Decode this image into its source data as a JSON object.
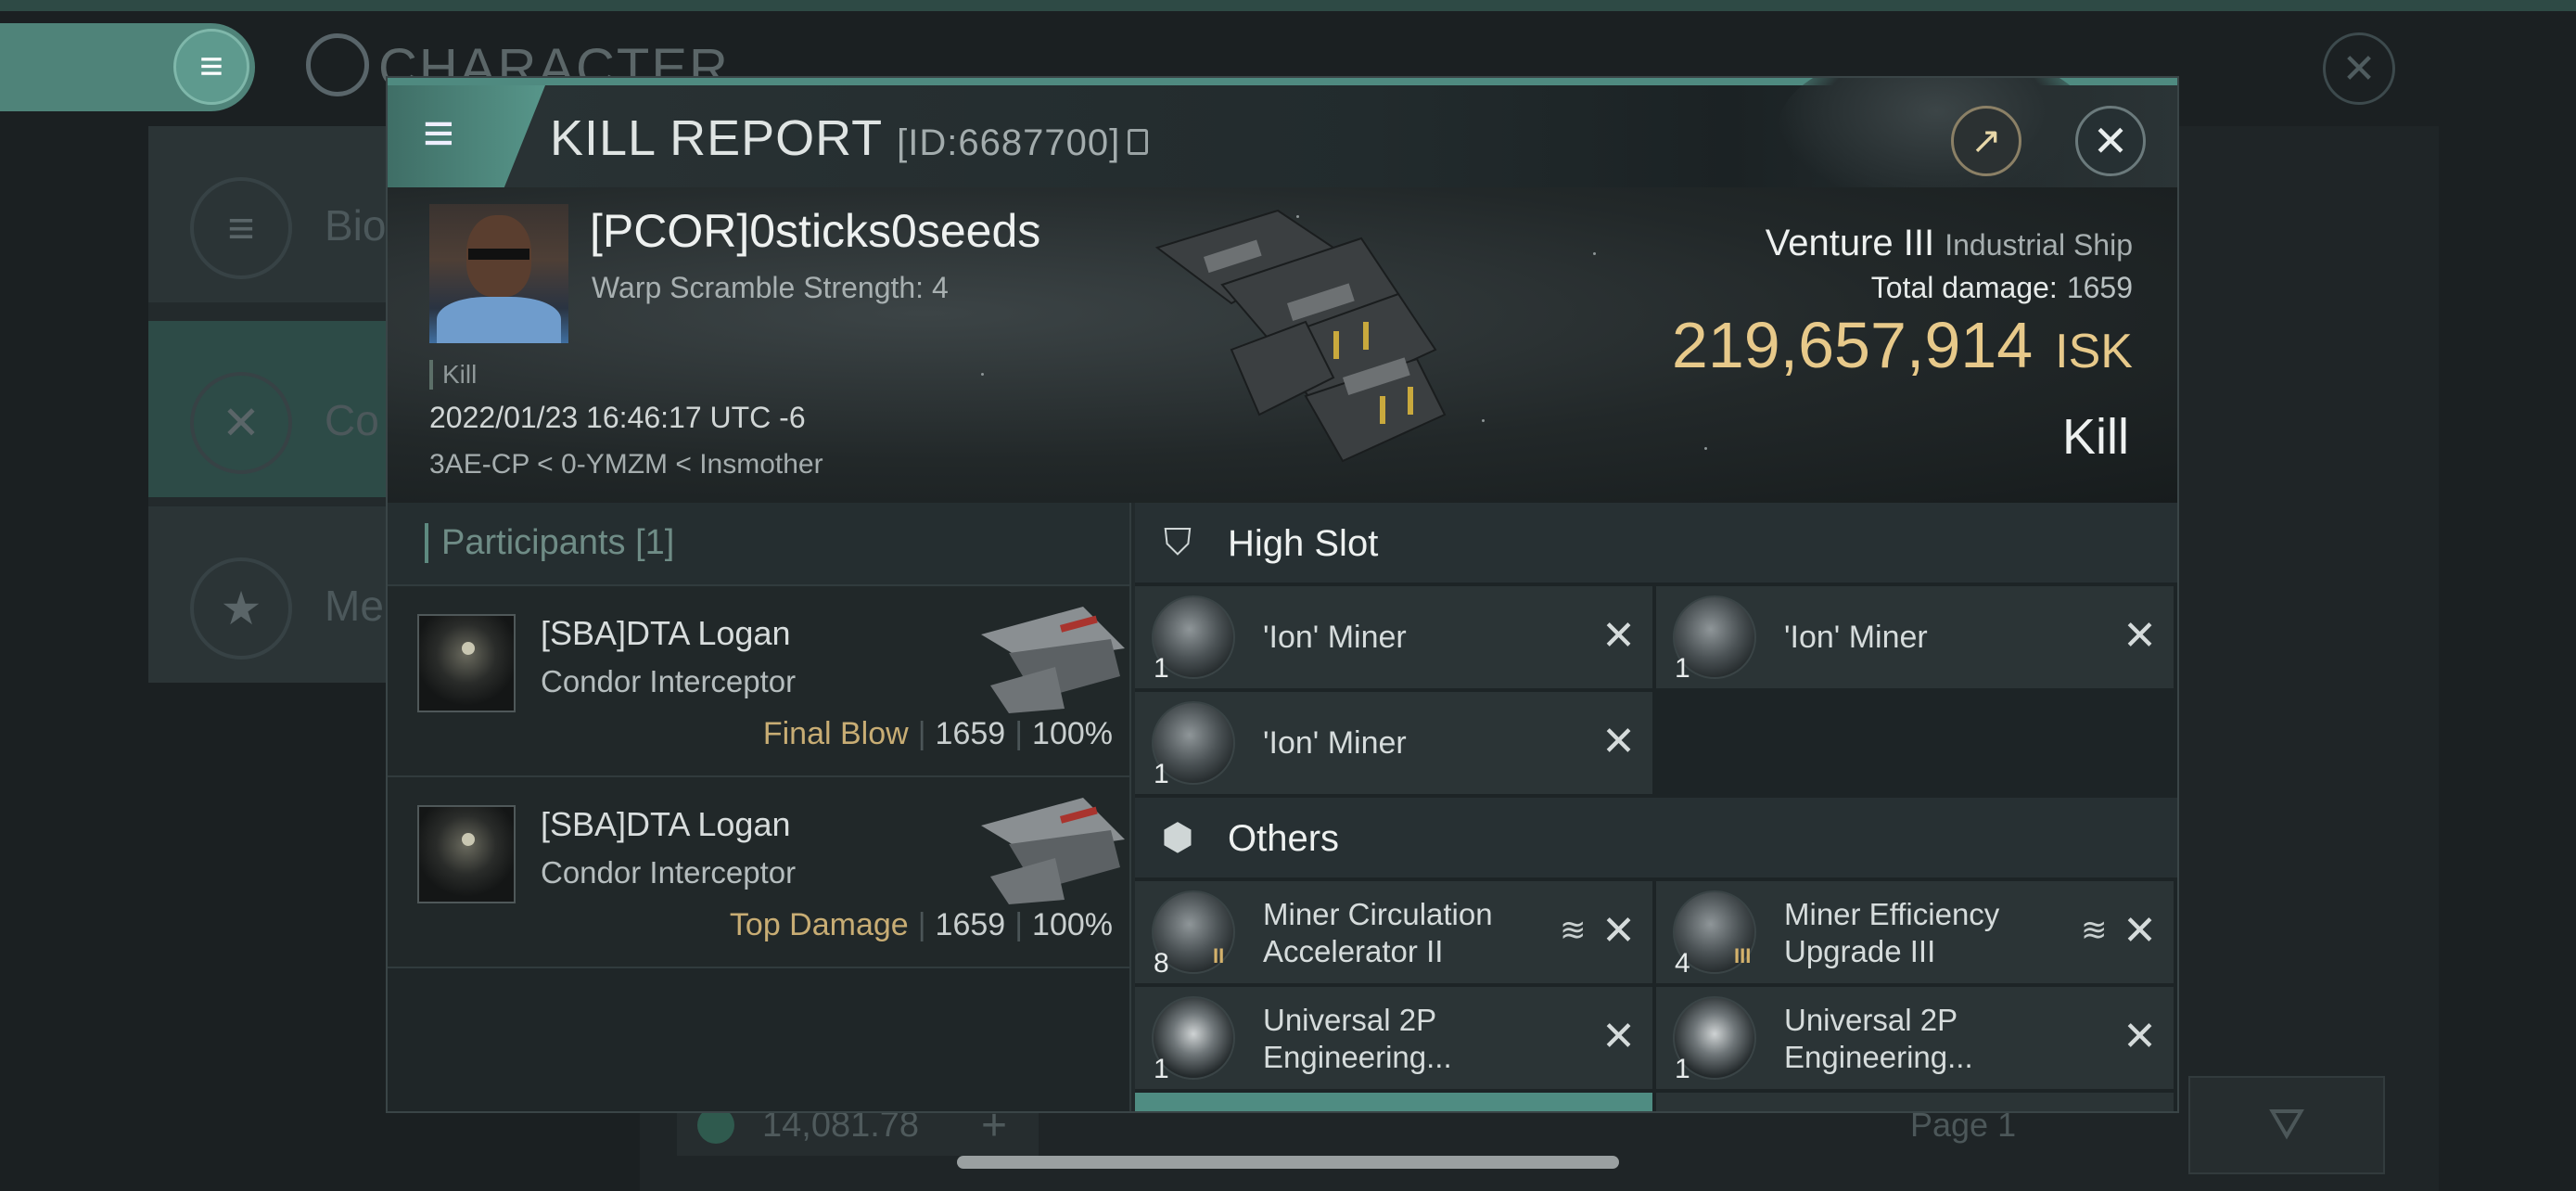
{
  "background": {
    "title": "CHARACTER",
    "side_items": [
      "Bio",
      "Co",
      "Me"
    ],
    "isk_value": "14,081.78",
    "page_label": "Page 1"
  },
  "modal": {
    "title": "KILL REPORT",
    "id": "[ID:6687700]",
    "victim": {
      "name": "[PCOR]0sticks0seeds",
      "warp": "Warp Scramble Strength: 4",
      "tag": "Kill",
      "time": "2022/01/23 16:46:17 UTC -6",
      "location": "3AE-CP < 0-YMZM < Insmother",
      "ship": "Venture III",
      "ship_class": "Industrial Ship",
      "damage_label": "Total damage:",
      "damage": "1659",
      "isk": "219,657,914",
      "isk_unit": "ISK",
      "result": "Kill"
    },
    "participants": {
      "header": "Participants [1]",
      "rows": [
        {
          "name": "[SBA]DTA Logan",
          "ship": "Condor Interceptor",
          "role": "Final Blow",
          "damage": "1659",
          "percent": "100%"
        },
        {
          "name": "[SBA]DTA Logan",
          "ship": "Condor Interceptor",
          "role": "Top Damage",
          "damage": "1659",
          "percent": "100%"
        }
      ]
    },
    "high_slot": {
      "title": "High Slot",
      "items": [
        {
          "name": "'Ion' Miner",
          "qty": "1"
        },
        {
          "name": "'Ion' Miner",
          "qty": "1"
        },
        {
          "name": "'Ion' Miner",
          "qty": "1"
        }
      ]
    },
    "others": {
      "title": "Others",
      "items": [
        {
          "name": "Miner Circulation Accelerator II",
          "qty": "8"
        },
        {
          "name": "Miner Efficiency Upgrade III",
          "qty": "4"
        },
        {
          "name": "Universal 2P Engineering...",
          "qty": "1"
        },
        {
          "name": "Universal 2P Engineering...",
          "qty": "1"
        }
      ]
    }
  },
  "colors": {
    "accent": "#4f8a80",
    "isk": "#e7c98a",
    "gold": "#c8ad74"
  },
  "icons": [
    "menu-icon",
    "copy-icon",
    "share-icon",
    "close-icon",
    "turret-icon",
    "cube-icon",
    "stack-icon",
    "filter-icon"
  ]
}
